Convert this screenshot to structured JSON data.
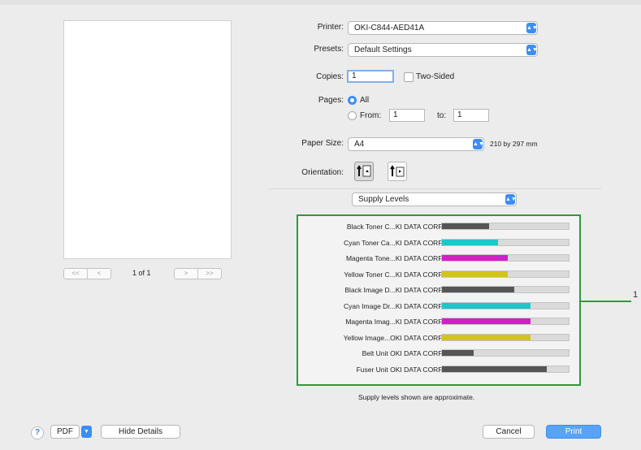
{
  "preview": {
    "first_label": "<<",
    "prev_label": "<",
    "page_count": "1 of 1",
    "next_label": ">",
    "last_label": ">>"
  },
  "printer": {
    "label": "Printer:",
    "value": "OKI-C844-AED41A"
  },
  "presets": {
    "label": "Presets:",
    "value": "Default Settings"
  },
  "copies": {
    "label": "Copies:",
    "value": "1",
    "two_sided_label": "Two-Sided"
  },
  "pages": {
    "label": "Pages:",
    "all_label": "All",
    "from_label": "From:",
    "from_value": "1",
    "to_label": "to:",
    "to_value": "1"
  },
  "paper_size": {
    "label": "Paper Size:",
    "value": "A4",
    "dimensions": "210 by 297 mm"
  },
  "orientation": {
    "label": "Orientation:",
    "selected": "portrait"
  },
  "section_popup": {
    "value": "Supply Levels"
  },
  "supplies": [
    {
      "name": "Black Toner C...KI DATA CORP",
      "level": 0.37,
      "color": "#555555"
    },
    {
      "name": "Cyan Toner Ca...KI DATA CORP",
      "level": 0.44,
      "color": "#1cc6c9"
    },
    {
      "name": "Magenta Tone...KI DATA CORP",
      "level": 0.52,
      "color": "#d21fc9"
    },
    {
      "name": "Yellow Toner C...KI DATA CORP",
      "level": 0.52,
      "color": "#d2c41c"
    },
    {
      "name": "Black Image D...KI DATA CORP",
      "level": 0.57,
      "color": "#555555"
    },
    {
      "name": "Cyan Image Dr...KI DATA CORP",
      "level": 0.7,
      "color": "#1cc6c9"
    },
    {
      "name": "Magenta Imag...KI DATA CORP",
      "level": 0.7,
      "color": "#d21fc9"
    },
    {
      "name": "Yellow Image...OKI DATA CORP",
      "level": 0.7,
      "color": "#d2c41c"
    },
    {
      "name": "Belt Unit OKI DATA CORP",
      "level": 0.25,
      "color": "#555555"
    },
    {
      "name": "Fuser Unit OKI DATA CORP",
      "level": 0.83,
      "color": "#555555"
    }
  ],
  "supply_note": "Supply levels shown are approximate.",
  "callout": {
    "number": "1",
    "color": "#2f9a3a"
  },
  "footer": {
    "help_label": "?",
    "pdf_label": "PDF",
    "hide_details_label": "Hide Details",
    "cancel_label": "Cancel",
    "print_label": "Print"
  },
  "colors": {
    "accent": "#3a8ef6",
    "highlight": "#2f9a3a"
  }
}
